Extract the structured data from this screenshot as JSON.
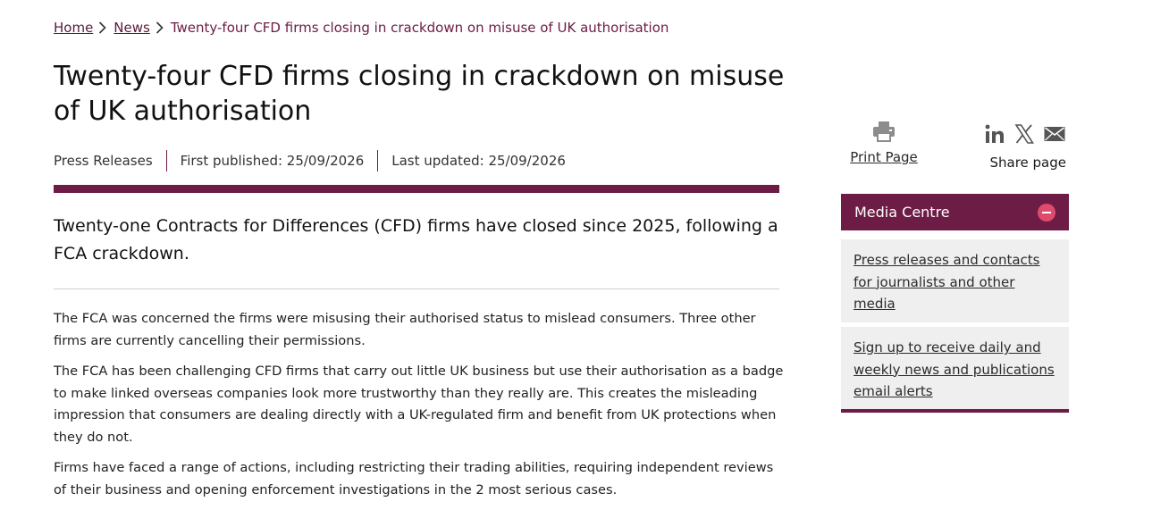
{
  "breadcrumb": {
    "home": "Home",
    "news": "News",
    "current": "Twenty-four CFD firms closing in crackdown on misuse of UK authorisation"
  },
  "article": {
    "title": "Twenty-four CFD firms closing in crackdown on misuse of UK authorisation",
    "category": "Press Releases",
    "first_published": "First published: 25/09/2026",
    "last_updated": "Last updated: 25/09/2026",
    "lede": "Twenty-one Contracts for Differences (CFD) firms have closed since 2025, following a FCA crackdown.",
    "paragraphs": [
      "The FCA was concerned the firms were misusing their authorised status to mislead consumers. Three other firms are currently cancelling their permissions.",
      "The FCA has been challenging CFD firms that carry out little UK business but use their authorisation as a badge to make linked overseas companies look more trustworthy than they really are. This creates the misleading impression that consumers are dealing directly with a UK-regulated firm and benefit from UK protections when they do not.",
      "Firms have faced a range of actions, including restricting their trading abilities, requiring independent reviews of their business and opening enforcement investigations in the 2 most serious cases."
    ]
  },
  "tools": {
    "print_label": "Print Page",
    "share_label": "Share page",
    "icons": [
      "printer-icon",
      "linkedin-icon",
      "x-icon",
      "email-icon"
    ]
  },
  "media_centre": {
    "title": "Media Centre",
    "links": [
      "Press releases and contacts for journalists and other media",
      "Sign up to receive daily and weekly news and publications email alerts"
    ]
  },
  "colors": {
    "brand": "#6d1c45",
    "toggle": "#e04b6d",
    "panel_bg": "#efefef"
  }
}
